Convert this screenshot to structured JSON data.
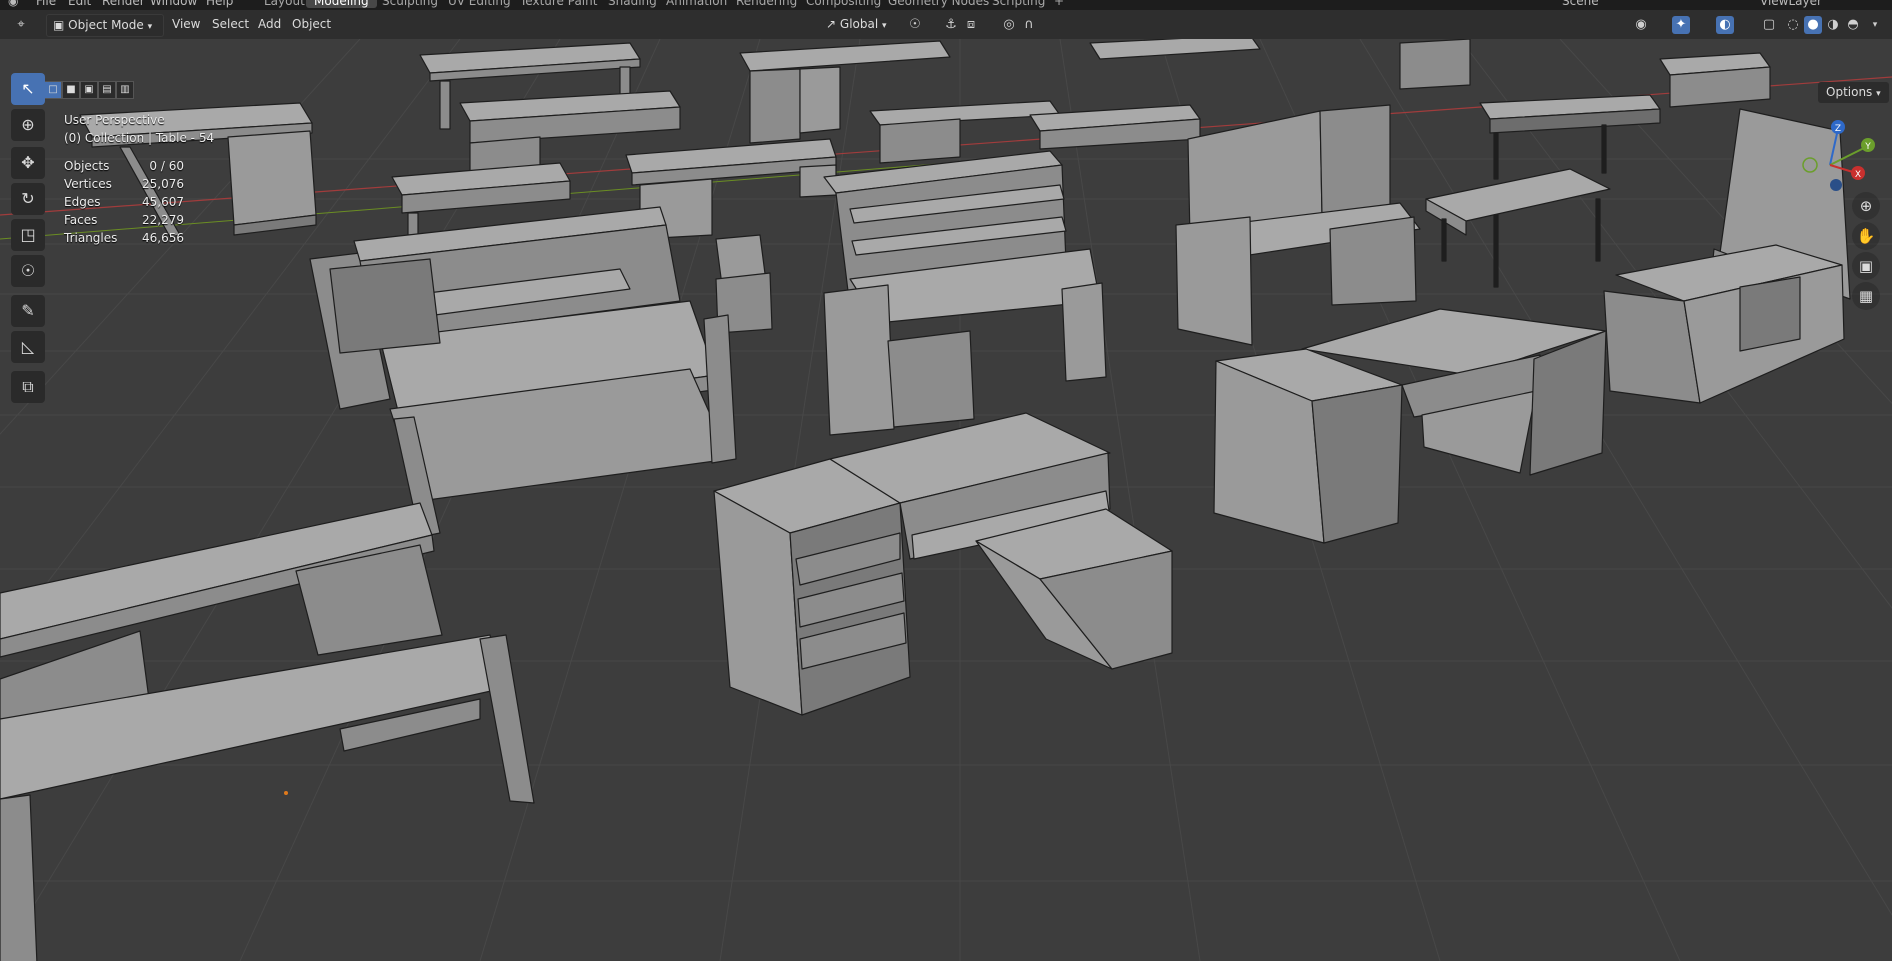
{
  "topbar": {
    "menus": [
      "File",
      "Edit",
      "Render",
      "Window",
      "Help"
    ],
    "workspaces": [
      "Layout",
      "Modeling",
      "Sculpting",
      "UV Editing",
      "Texture Paint",
      "Shading",
      "Animation",
      "Rendering",
      "Compositing",
      "Geometry Nodes",
      "Scripting",
      "+"
    ],
    "active_workspace": "Modeling",
    "scene": "Scene",
    "view_layer": "ViewLayer"
  },
  "header": {
    "mode": "Object Mode",
    "menus": [
      "View",
      "Select",
      "Add",
      "Object"
    ],
    "transform_orientation": "Global"
  },
  "viewport": {
    "perspective": "User Perspective",
    "collection": "(0) Collection | Table - 54",
    "stats": [
      {
        "label": "Objects",
        "value": "0 / 60"
      },
      {
        "label": "Vertices",
        "value": "25,076"
      },
      {
        "label": "Edges",
        "value": "45,607"
      },
      {
        "label": "Faces",
        "value": "22,279"
      },
      {
        "label": "Triangles",
        "value": "46,656"
      }
    ],
    "options_label": "Options",
    "gizmo_axes": [
      "X",
      "Y",
      "Z"
    ]
  },
  "toolbar": {
    "tools": [
      "select-box-icon",
      "cursor-icon",
      "move-icon",
      "rotate-icon",
      "scale-icon",
      "transform-icon",
      "annotate-icon",
      "measure-icon",
      "add-cube-icon"
    ],
    "active_tool": "select-box-icon"
  },
  "colors": {
    "grid_bg": "#3d3d3d",
    "grid_line": "#474747",
    "x_axis": "#a13c3c",
    "y_axis": "#6b8e23",
    "furniture_top": "#a9a9a9",
    "furniture_side": "#8c8c8c",
    "furniture_edge": "#1e1e1e",
    "accent": "#4772b3"
  }
}
